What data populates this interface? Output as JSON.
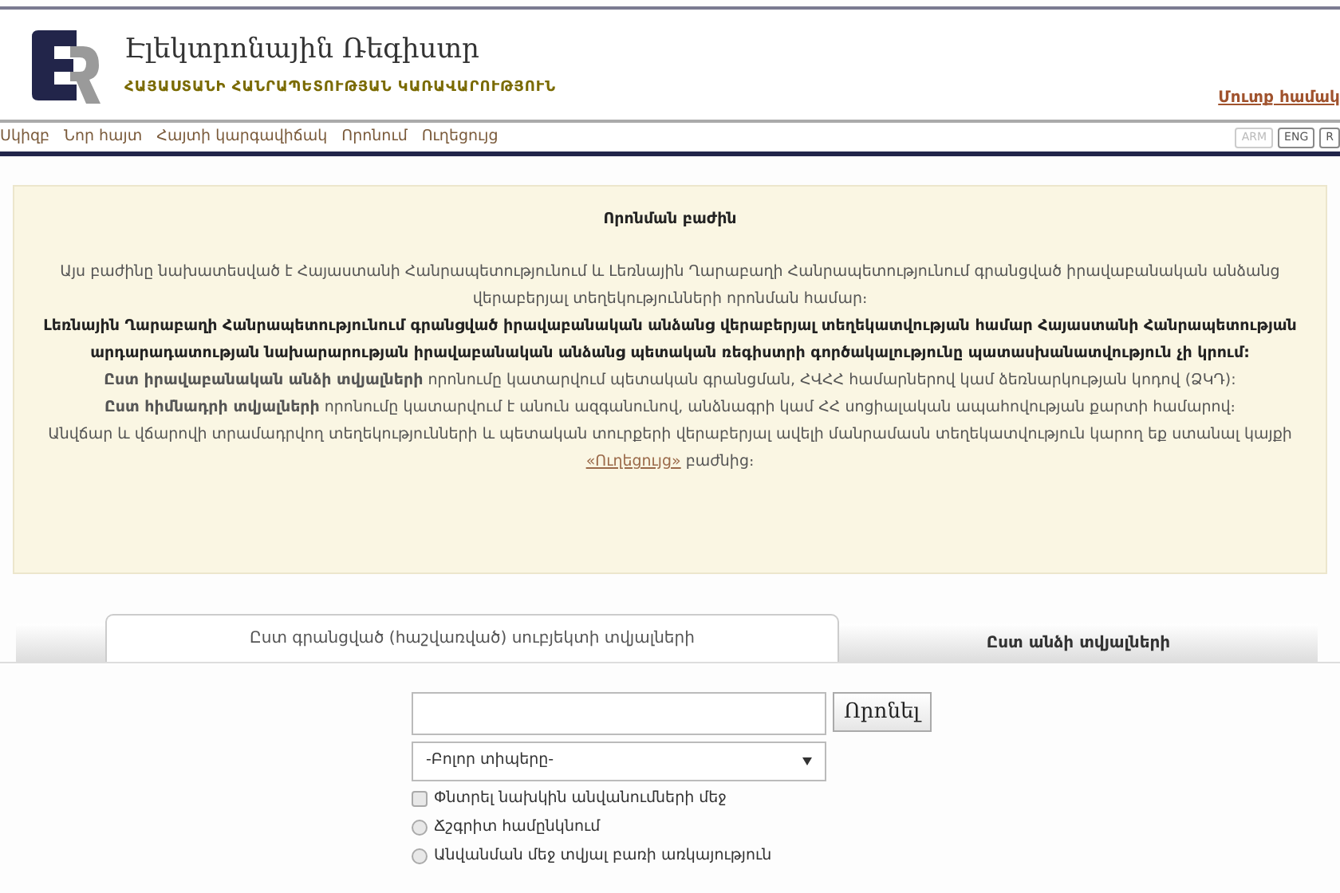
{
  "header": {
    "title": "Էլեկտրոնային Ռեգիստր",
    "subtitle": "ՀԱՅԱՍՏԱՆԻ ՀԱՆՐԱՊԵՏՈՒԹՅԱՆ ԿԱՌԱՎԱՐՈՒԹՅՈՒՆ",
    "login_link": "Մուտք համակ"
  },
  "nav": {
    "items": [
      "Սկիզբ",
      "Նոր հայտ",
      "Հայտի կարգավիճակ",
      "Որոնում",
      "Ուղեցույց"
    ],
    "languages": [
      {
        "label": "ARM",
        "selected": true
      },
      {
        "label": "ENG",
        "selected": false
      },
      {
        "label": "R",
        "selected": false
      }
    ]
  },
  "info_panel": {
    "title": "Որոնման բաժին",
    "paragraphs": [
      {
        "kind": "plain",
        "text": "Այս բաժինը նախատեսված է Հայաստանի Հանրապետությունում և Լեռնային Ղարաբաղի Հանրապետությունում գրանցված իրավաբանական անձանց վերաբերյալ տեղեկությունների որոնման համար։"
      },
      {
        "kind": "bold",
        "text": "Լեռնային Ղարաբաղի Հանրապետությունում գրանցված իրավաբանական անձանց վերաբերյալ տեղեկատվության համար Հայաստանի Հանրապետության արդարադատության նախարարության իրավաբանական անձանց պետական ռեգիստրի գործակալությունը պատասխանատվություն չի կրում:"
      },
      {
        "kind": "plain",
        "text": "**Ըստ իրավաբանական անձի տվյալների** որոնումը կատարվում պետական գրանցման, ՀՎՀՀ համարներով կամ ձեռնարկության կոդով (ՁԿԴ):"
      },
      {
        "kind": "plain",
        "text": "**Ըստ հիմնադրի տվյալների** որոնումը կատարվում է անուն ազգանունով, անձնագրի կամ ՀՀ սոցիալական ապահովության քարտի համարով։"
      },
      {
        "kind": "link",
        "text": "Անվճար և վճարովի տրամադրվող տեղեկությունների և պետական տուրքերի վերաբերյալ ավելի մանրամասն տեղեկատվություն կարող եք ստանալ կայքի",
        "link": "«Ուղեցույց»",
        "after": "բաժնից։"
      }
    ]
  },
  "tabs": [
    {
      "label": "Ըստ գրանցված (հաշվառված) սուբյեկտի տվյալների",
      "selected": true
    },
    {
      "label": "Ըստ անձի տվյալների",
      "selected": false
    }
  ],
  "search_form": {
    "button": "Որոնել",
    "type_select": "-Բոլոր տիպերը-",
    "options": [
      {
        "kind": "checkbox",
        "label": "Փնտրել նախկին անվանումների մեջ",
        "checked": false
      },
      {
        "kind": "radio",
        "label": "Ճշգրիտ համընկնում",
        "checked": false
      },
      {
        "kind": "radio",
        "label": "Անվանման մեջ տվյալ բառի առկայություն",
        "checked": false
      }
    ]
  }
}
